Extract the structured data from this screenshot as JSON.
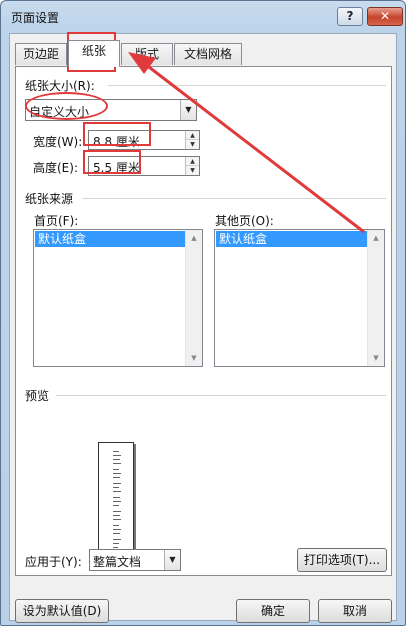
{
  "window": {
    "title": "页面设置",
    "help_label": "?",
    "close_label": "✕"
  },
  "tabs": [
    {
      "label": "页边距",
      "active": false
    },
    {
      "label": "纸张",
      "active": true
    },
    {
      "label": "版式",
      "active": false
    },
    {
      "label": "文档网格",
      "active": false
    }
  ],
  "paper_size": {
    "section_label": "纸张大小(R):",
    "selected": "自定义大小",
    "width_label": "宽度(W):",
    "width_value": "8.8 厘米",
    "height_label": "高度(E):",
    "height_value": "5.5 厘米"
  },
  "paper_source": {
    "section_label": "纸张来源",
    "first_page_label": "首页(F):",
    "first_page_items": [
      "默认纸盒"
    ],
    "other_pages_label": "其他页(O):",
    "other_pages_items": [
      "默认纸盒"
    ]
  },
  "preview": {
    "section_label": "预览"
  },
  "apply_to": {
    "label": "应用于(Y):",
    "selected": "整篇文档"
  },
  "buttons": {
    "print_options": "打印选项(T)...",
    "set_default": "设为默认值(D)",
    "ok": "确定",
    "cancel": "取消"
  },
  "colors": {
    "annotation": "#e03a3a",
    "selection": "#3399ff"
  }
}
